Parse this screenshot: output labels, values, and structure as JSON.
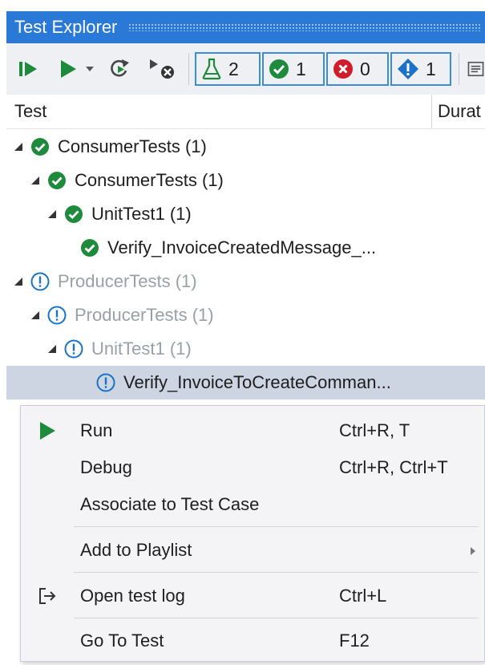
{
  "window": {
    "title": "Test Explorer"
  },
  "toolbar": {
    "filters": [
      {
        "name": "total",
        "count": "2"
      },
      {
        "name": "passed",
        "count": "1"
      },
      {
        "name": "failed",
        "count": "0"
      },
      {
        "name": "not-run",
        "count": "1"
      }
    ]
  },
  "columns": {
    "test": "Test",
    "duration": "Durat"
  },
  "tree": [
    {
      "label": "ConsumerTests (1)",
      "status": "passed"
    },
    {
      "label": "ConsumerTests (1)",
      "status": "passed"
    },
    {
      "label": "UnitTest1 (1)",
      "status": "passed"
    },
    {
      "label": "Verify_InvoiceCreatedMessage_...",
      "status": "passed"
    },
    {
      "label": "ProducerTests (1)",
      "status": "not-run"
    },
    {
      "label": "ProducerTests (1)",
      "status": "not-run"
    },
    {
      "label": "UnitTest1 (1)",
      "status": "not-run"
    },
    {
      "label": "Verify_InvoiceToCreateComman...",
      "status": "not-run",
      "selected": true
    }
  ],
  "context_menu": {
    "items": [
      {
        "label": "Run",
        "shortcut": "Ctrl+R, T",
        "icon": "play-icon"
      },
      {
        "label": "Debug",
        "shortcut": "Ctrl+R, Ctrl+T"
      },
      {
        "label": "Associate to Test Case",
        "shortcut": ""
      },
      {
        "label": "Add to Playlist",
        "shortcut": "",
        "submenu": true
      },
      {
        "label": "Open test log",
        "shortcut": "Ctrl+L",
        "icon": "open-log-icon"
      },
      {
        "label": "Go To Test",
        "shortcut": "F12"
      }
    ]
  },
  "colors": {
    "title_bar": "#2a79d7",
    "passed": "#1e8a3c",
    "failed": "#d01c2a",
    "not_run": "#1a73c7",
    "selection": "#cdd4e2"
  }
}
